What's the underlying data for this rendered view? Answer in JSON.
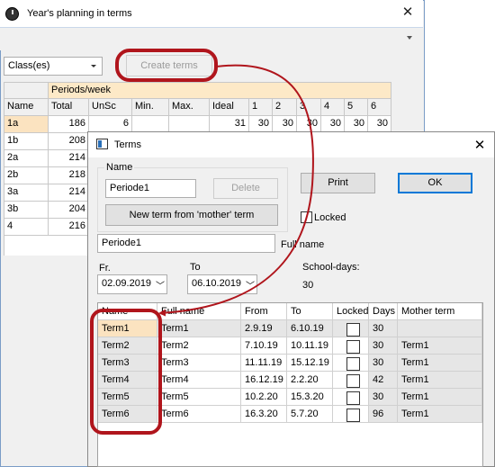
{
  "main_window": {
    "title": "Year's planning in terms",
    "close_icon": "close-icon",
    "class_select": "Class(es)",
    "create_terms_label": "Create terms",
    "grid": {
      "group_header": "Periods/week",
      "headers": [
        "Name",
        "Total",
        "UnSc",
        "Min.",
        "Max.",
        "Ideal",
        "1",
        "2",
        "3",
        "4",
        "5",
        "6"
      ],
      "rows": [
        {
          "name": "1a",
          "total": "186",
          "unsc": "6",
          "min": "",
          "max": "",
          "ideal": "31",
          "p1": "30",
          "p2": "30",
          "p3": "30",
          "p4": "30",
          "p5": "30",
          "p6": "30"
        },
        {
          "name": "1b",
          "total": "208"
        },
        {
          "name": "2a",
          "total": "214"
        },
        {
          "name": "2b",
          "total": "218"
        },
        {
          "name": "3a",
          "total": "214"
        },
        {
          "name": "3b",
          "total": "204"
        },
        {
          "name": "4",
          "total": "216"
        }
      ]
    }
  },
  "dialog": {
    "title": "Terms",
    "name_group_label": "Name",
    "name_value": "Periode1",
    "delete_label": "Delete",
    "new_term_label": "New term from 'mother' term",
    "print_label": "Print",
    "ok_label": "OK",
    "locked_label": "Locked",
    "fullname_value": "Periode1",
    "fullname_label": "Full name",
    "from_label": "Fr.",
    "to_label": "To",
    "from_date": "02.09.2019",
    "to_date": "06.10.2019",
    "schooldays_label": "School-days:",
    "schooldays_value": "30",
    "table": {
      "headers": [
        "Name",
        "Full name",
        "From",
        "To",
        "Locked",
        "Days",
        "Mother term"
      ],
      "rows": [
        {
          "name": "Term1",
          "fullname": "Term1",
          "from": "2.9.19",
          "to": "6.10.19",
          "days": "30",
          "mother": ""
        },
        {
          "name": "Term2",
          "fullname": "Term2",
          "from": "7.10.19",
          "to": "10.11.19",
          "days": "30",
          "mother": "Term1"
        },
        {
          "name": "Term3",
          "fullname": "Term3",
          "from": "11.11.19",
          "to": "15.12.19",
          "days": "30",
          "mother": "Term1"
        },
        {
          "name": "Term4",
          "fullname": "Term4",
          "from": "16.12.19",
          "to": "2.2.20",
          "days": "42",
          "mother": "Term1"
        },
        {
          "name": "Term5",
          "fullname": "Term5",
          "from": "10.2.20",
          "to": "15.3.20",
          "days": "30",
          "mother": "Term1"
        },
        {
          "name": "Term6",
          "fullname": "Term6",
          "from": "16.3.20",
          "to": "5.7.20",
          "days": "96",
          "mother": "Term1"
        }
      ]
    }
  },
  "colors": {
    "highlight_ring": "#b0151c",
    "selected_row": "#fbe3c0",
    "group_header": "#fde9c7"
  }
}
